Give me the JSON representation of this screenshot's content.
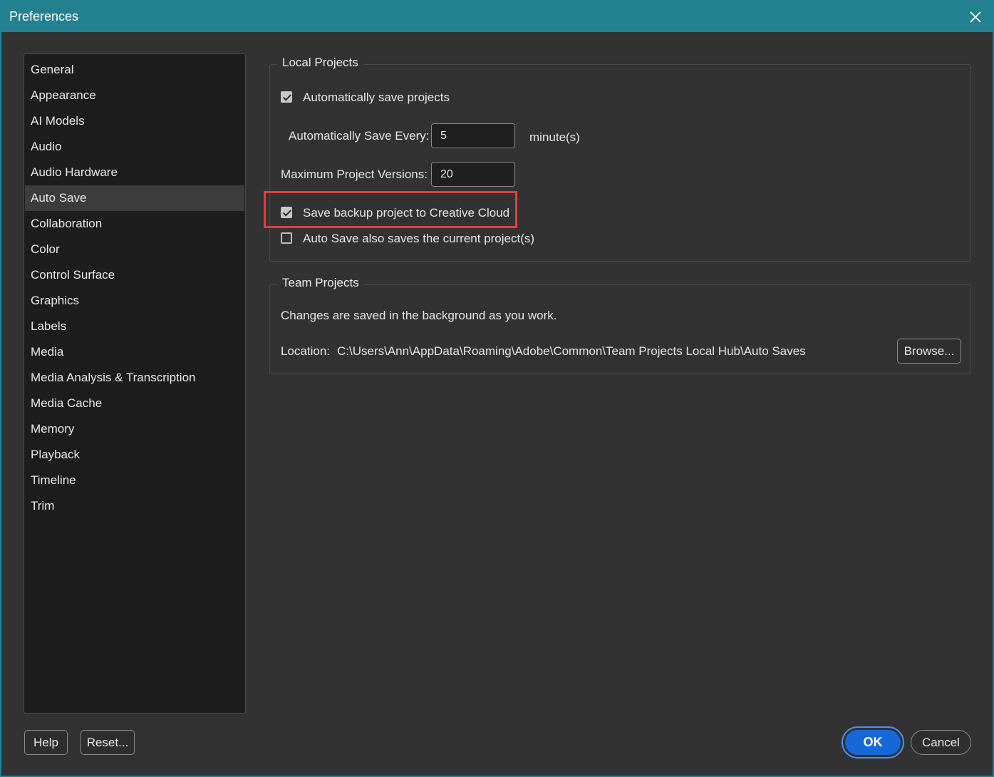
{
  "window": {
    "title": "Preferences"
  },
  "sidebar": {
    "items": [
      {
        "label": "General"
      },
      {
        "label": "Appearance"
      },
      {
        "label": "AI Models"
      },
      {
        "label": "Audio"
      },
      {
        "label": "Audio Hardware"
      },
      {
        "label": "Auto Save",
        "selected": true
      },
      {
        "label": "Collaboration"
      },
      {
        "label": "Color"
      },
      {
        "label": "Control Surface"
      },
      {
        "label": "Graphics"
      },
      {
        "label": "Labels"
      },
      {
        "label": "Media"
      },
      {
        "label": "Media Analysis & Transcription"
      },
      {
        "label": "Media Cache"
      },
      {
        "label": "Memory"
      },
      {
        "label": "Playback"
      },
      {
        "label": "Timeline"
      },
      {
        "label": "Trim"
      }
    ]
  },
  "local_projects": {
    "title": "Local Projects",
    "auto_save_label": "Automatically save projects",
    "auto_save_checked": true,
    "save_every_label": "Automatically Save Every:",
    "save_every_value": "5",
    "save_every_unit": "minute(s)",
    "max_versions_label": "Maximum Project Versions:",
    "max_versions_value": "20",
    "backup_cloud_label": "Save backup project to Creative Cloud",
    "backup_cloud_checked": true,
    "also_saves_label": "Auto Save also saves the current project(s)",
    "also_saves_checked": false
  },
  "team_projects": {
    "title": "Team Projects",
    "description": "Changes are saved in the background as you work.",
    "location_label": "Location:",
    "location_path": "C:\\Users\\Ann\\AppData\\Roaming\\Adobe\\Common\\Team Projects Local Hub\\Auto Saves",
    "browse_label": "Browse..."
  },
  "footer": {
    "help_label": "Help",
    "reset_label": "Reset...",
    "ok_label": "OK",
    "cancel_label": "Cancel"
  },
  "colors": {
    "titlebar": "#23818f",
    "highlight": "#e0403f",
    "primary": "#1667d7"
  }
}
